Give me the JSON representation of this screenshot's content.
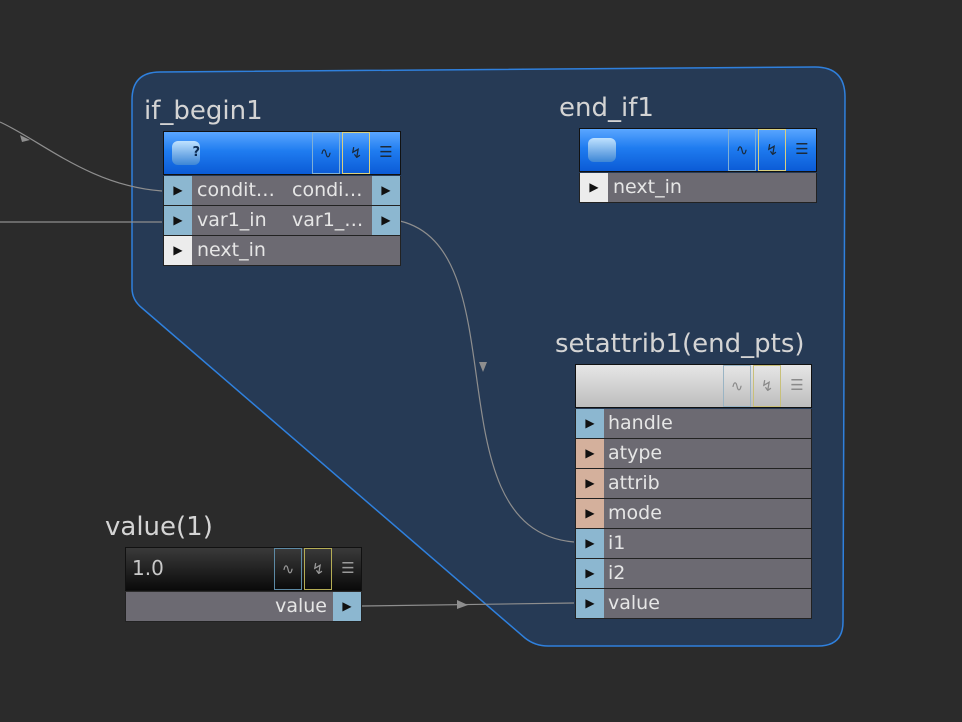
{
  "network_box": {
    "fill": "#263a55",
    "stroke": "#2f80dd"
  },
  "nodes": {
    "if_begin": {
      "title": "if_begin1",
      "icon": "if-block-begin-icon",
      "rows": [
        {
          "in": "condit…",
          "out": "condi…"
        },
        {
          "in": "var1_in",
          "out": "var1_…"
        },
        {
          "in": "next_in",
          "out": ""
        }
      ]
    },
    "end_if": {
      "title": "end_if1",
      "icon": "if-block-end-icon",
      "rows": [
        {
          "in": "next_in"
        }
      ]
    },
    "setattrib": {
      "title": "setattrib1(end_pts)",
      "rows": [
        {
          "in": "handle"
        },
        {
          "in": "atype"
        },
        {
          "in": "attrib"
        },
        {
          "in": "mode"
        },
        {
          "in": "i1"
        },
        {
          "in": "i2"
        },
        {
          "in": "value"
        }
      ]
    },
    "value": {
      "title": "value(1)",
      "display_value": "1.0",
      "rows": [
        {
          "out": "value"
        }
      ]
    }
  },
  "icons": {
    "port_arrow": "▶",
    "bypass": "bypass-flag-icon",
    "debug": "debug-flag-icon",
    "menu": "node-menu-icon"
  }
}
